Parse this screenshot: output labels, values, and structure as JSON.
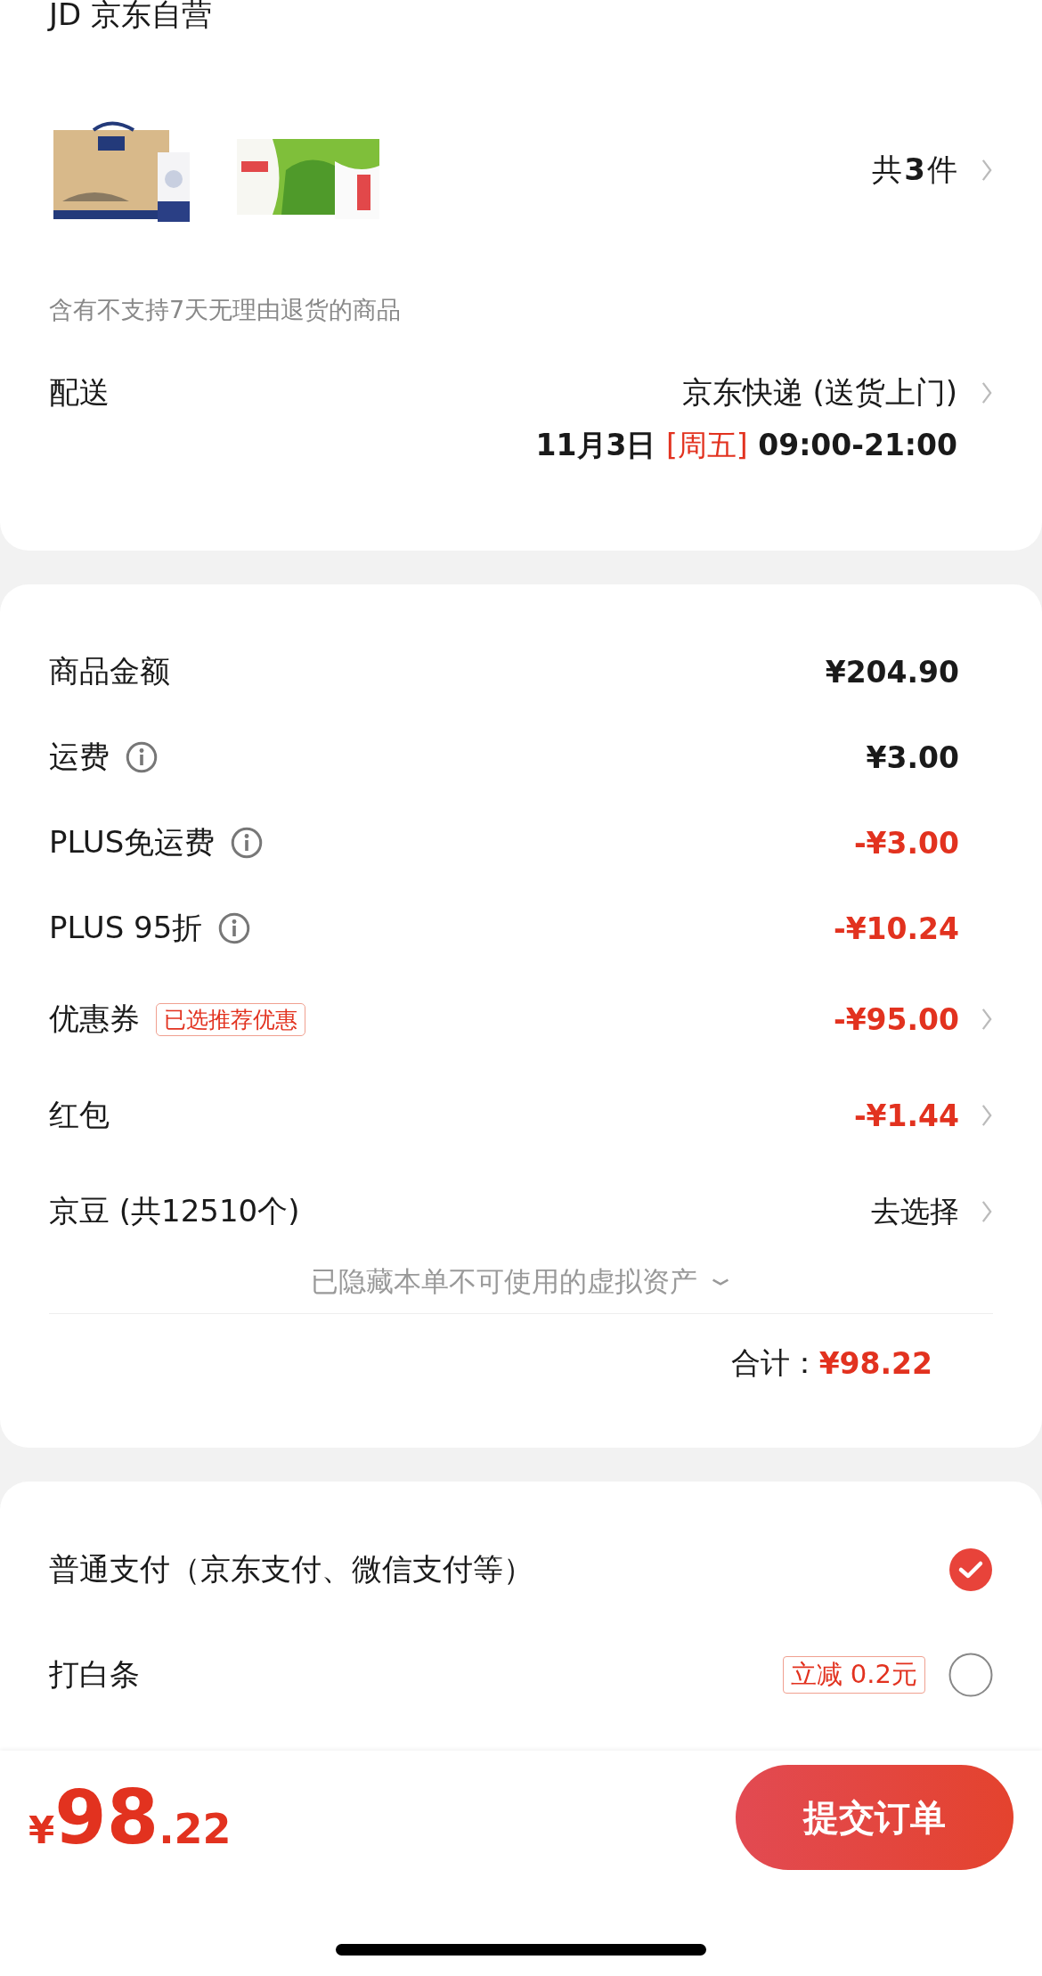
{
  "shop": {
    "title": "JD 京东自营"
  },
  "products": {
    "count_prefix": "共",
    "count": "3",
    "count_suffix": "件"
  },
  "notice": "含有不支持7天无理由退货的商品",
  "delivery": {
    "label": "配送",
    "method": "京东快递 (送货上门)",
    "date": "11月3日",
    "weekday": "[周五]",
    "time": "09:00-21:00"
  },
  "amounts": [
    {
      "label": "商品金额",
      "info": false,
      "value": "¥204.90",
      "kind": "normal",
      "arrow": false
    },
    {
      "label": "运费",
      "info": true,
      "value": "¥3.00",
      "kind": "normal",
      "arrow": false
    },
    {
      "label": "PLUS免运费",
      "info": true,
      "value": "-¥3.00",
      "kind": "discount",
      "arrow": false
    },
    {
      "label": "PLUS 95折",
      "info": true,
      "value": "-¥10.24",
      "kind": "discount",
      "arrow": false
    },
    {
      "label": "优惠券",
      "info": false,
      "tag": "已选推荐优惠",
      "value": "-¥95.00",
      "kind": "discount",
      "arrow": true
    },
    {
      "label": "红包",
      "info": false,
      "value": "-¥1.44",
      "kind": "discount",
      "arrow": true
    },
    {
      "label": "京豆 (共12510个)",
      "info": false,
      "value": "去选择",
      "kind": "action",
      "arrow": true
    }
  ],
  "hidden_note": "已隐藏本单不可使用的虚拟资产",
  "total": {
    "label": "合计：",
    "value": "¥98.22"
  },
  "payments": [
    {
      "label": "普通支付（京东支付、微信支付等）",
      "selected": true
    },
    {
      "label": "打白条",
      "promo": "立减 0.2元",
      "selected": false
    }
  ],
  "footer": {
    "currency": "¥",
    "integer": "98",
    "decimal": ".22",
    "submit": "提交订单"
  }
}
